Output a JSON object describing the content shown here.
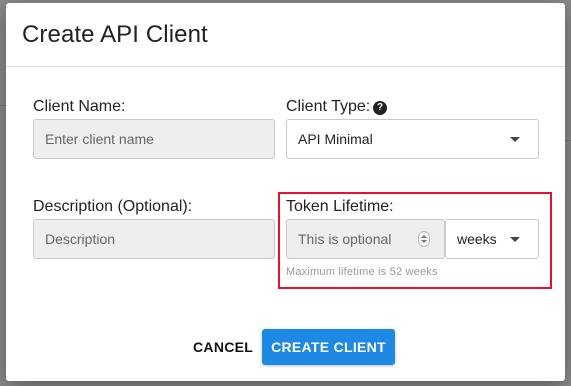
{
  "dialog": {
    "title": "Create API Client"
  },
  "form": {
    "client_name": {
      "label": "Client Name:",
      "value": "",
      "placeholder": "Enter client name"
    },
    "client_type": {
      "label": "Client Type:",
      "selected": "API Minimal",
      "help_icon": "help-circle-icon"
    },
    "description": {
      "label": "Description (Optional):",
      "value": "",
      "placeholder": "Description"
    },
    "token_lifetime": {
      "label": "Token Lifetime:",
      "value": "",
      "placeholder": "This is optional",
      "unit_selected": "weeks",
      "hint": "Maximum lifetime is 52 weeks"
    }
  },
  "actions": {
    "cancel_label": "CANCEL",
    "create_label": "CREATE CLIENT"
  },
  "colors": {
    "primary": "#1e88e5",
    "highlight": "#e8112d"
  }
}
